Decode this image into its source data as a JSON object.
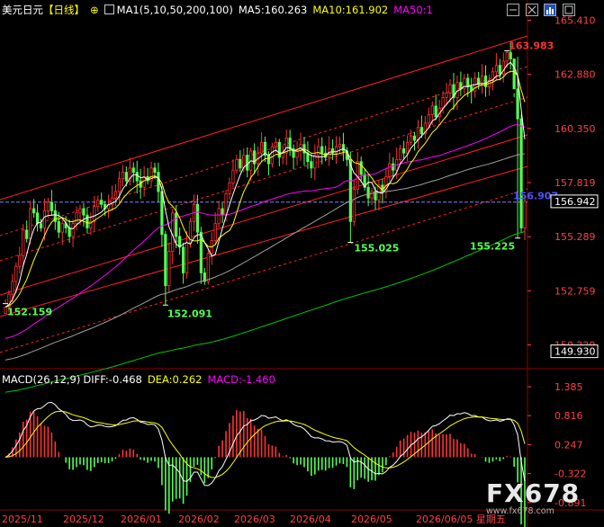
{
  "header": {
    "symbol": "美元日元",
    "period": "【日线】",
    "ma_title": "MA1(5,10,50,200,100)",
    "ma5": "MA5:160.263",
    "ma10": "MA10:161.902",
    "ma50": "MA50:1"
  },
  "macd_header": {
    "title": "MACD(26,12,9)",
    "diff": "DIFF:-0.468",
    "dea": "DEA:0.262",
    "macd": "MACD:-1.460"
  },
  "colors": {
    "up": "#ff3232",
    "down": "#54ff54",
    "ma5": "#ffffff",
    "ma10": "#ffff00",
    "ma50": "#ff00ff",
    "ma200": "#00c800",
    "ma100": "#a0a0a0",
    "channel": "#ff2020",
    "macd_diff": "#ffffff",
    "macd_dea": "#ffff00",
    "axis_text": "#ff4040",
    "grid": "#8b0000"
  },
  "watermark": {
    "brand": "FX678",
    "url": "www.fx678.com"
  },
  "chart_data": [
    {
      "type": "candlestick",
      "symbol": "美元日元",
      "ylim": [
        149.2,
        165.6
      ],
      "y_ticks": [
        165.41,
        162.88,
        160.35,
        157.819,
        155.289,
        152.759,
        150.229
      ],
      "x_ticks": [
        "2025/11",
        "2025/12",
        "2026/01",
        "2026/02",
        "2026/03",
        "2026/04",
        "2026/05",
        "2026/06/05 星期五"
      ],
      "price_labels": [
        {
          "text": "156.942",
          "value": 156.942,
          "style": "box"
        },
        {
          "text": "149.930",
          "value": 149.93,
          "style": "box"
        }
      ],
      "annotations": [
        {
          "text": "163.983",
          "index": 141,
          "value": 163.983,
          "color": "#ff3232"
        },
        {
          "text": "152.159",
          "index": 0,
          "value": 152.159,
          "color": "#54ff54"
        },
        {
          "text": "152.091",
          "index": 45,
          "value": 152.091,
          "color": "#54ff54"
        },
        {
          "text": "155.025",
          "index": 97,
          "value": 155.025,
          "color": "#54ff54"
        },
        {
          "text": "155.225",
          "index": 144,
          "value": 155.225,
          "color": "#54ff54"
        },
        {
          "text": "156.907",
          "index": 144,
          "value": 156.907,
          "color": "#5050ff"
        }
      ],
      "horizontal_line": 156.907,
      "closes": [
        152.0,
        152.6,
        153.2,
        153.9,
        154.4,
        155.6,
        155.2,
        156.6,
        156.4,
        155.9,
        155.7,
        156.5,
        156.9,
        156.5,
        156.0,
        155.5,
        155.9,
        155.7,
        155.3,
        155.9,
        156.4,
        156.6,
        156.3,
        155.7,
        156.0,
        156.7,
        157.0,
        156.8,
        156.6,
        156.8,
        157.1,
        157.4,
        158.0,
        158.3,
        157.9,
        158.5,
        158.3,
        157.9,
        157.6,
        158.1,
        157.9,
        158.5,
        158.3,
        157.4,
        155.4,
        153.0,
        154.6,
        156.4,
        155.3,
        154.8,
        153.6,
        155.0,
        156.0,
        156.8,
        155.5,
        153.6,
        153.2,
        154.5,
        155.1,
        155.9,
        156.6,
        156.3,
        157.3,
        157.8,
        158.4,
        158.9,
        158.5,
        159.1,
        158.4,
        159.3,
        158.7,
        159.2,
        159.7,
        159.1,
        158.7,
        159.5,
        159.7,
        159.0,
        159.2,
        159.9,
        159.4,
        159.0,
        159.3,
        159.6,
        159.2,
        158.8,
        158.5,
        159.1,
        159.5,
        159.2,
        159.0,
        159.4,
        159.2,
        159.5,
        159.6,
        159.3,
        158.9,
        156.0,
        157.5,
        158.8,
        158.2,
        157.6,
        157.1,
        157.4,
        157.0,
        157.7,
        157.4,
        158.1,
        158.7,
        158.4,
        158.9,
        159.4,
        159.2,
        159.7,
        160.0,
        159.8,
        160.4,
        160.1,
        160.6,
        161.0,
        161.4,
        160.9,
        161.3,
        161.8,
        162.0,
        162.4,
        161.8,
        162.5,
        162.2,
        162.7,
        162.3,
        162.1,
        162.7,
        162.4,
        162.8,
        162.3,
        162.6,
        163.0,
        163.3,
        162.9,
        163.5,
        163.9,
        163.6,
        162.2,
        160.8,
        155.7,
        156.94
      ],
      "ma5_end": 160.263,
      "ma10_end": 161.902
    },
    {
      "type": "bar",
      "name": "MACD(26,12,9)",
      "ylim": [
        -1.0,
        1.385
      ],
      "y_ticks": [
        1.385,
        0.816,
        0.247,
        -0.322,
        -0.891
      ],
      "diff_end": -0.468,
      "dea_end": 0.262,
      "macd_end": -1.46
    }
  ]
}
